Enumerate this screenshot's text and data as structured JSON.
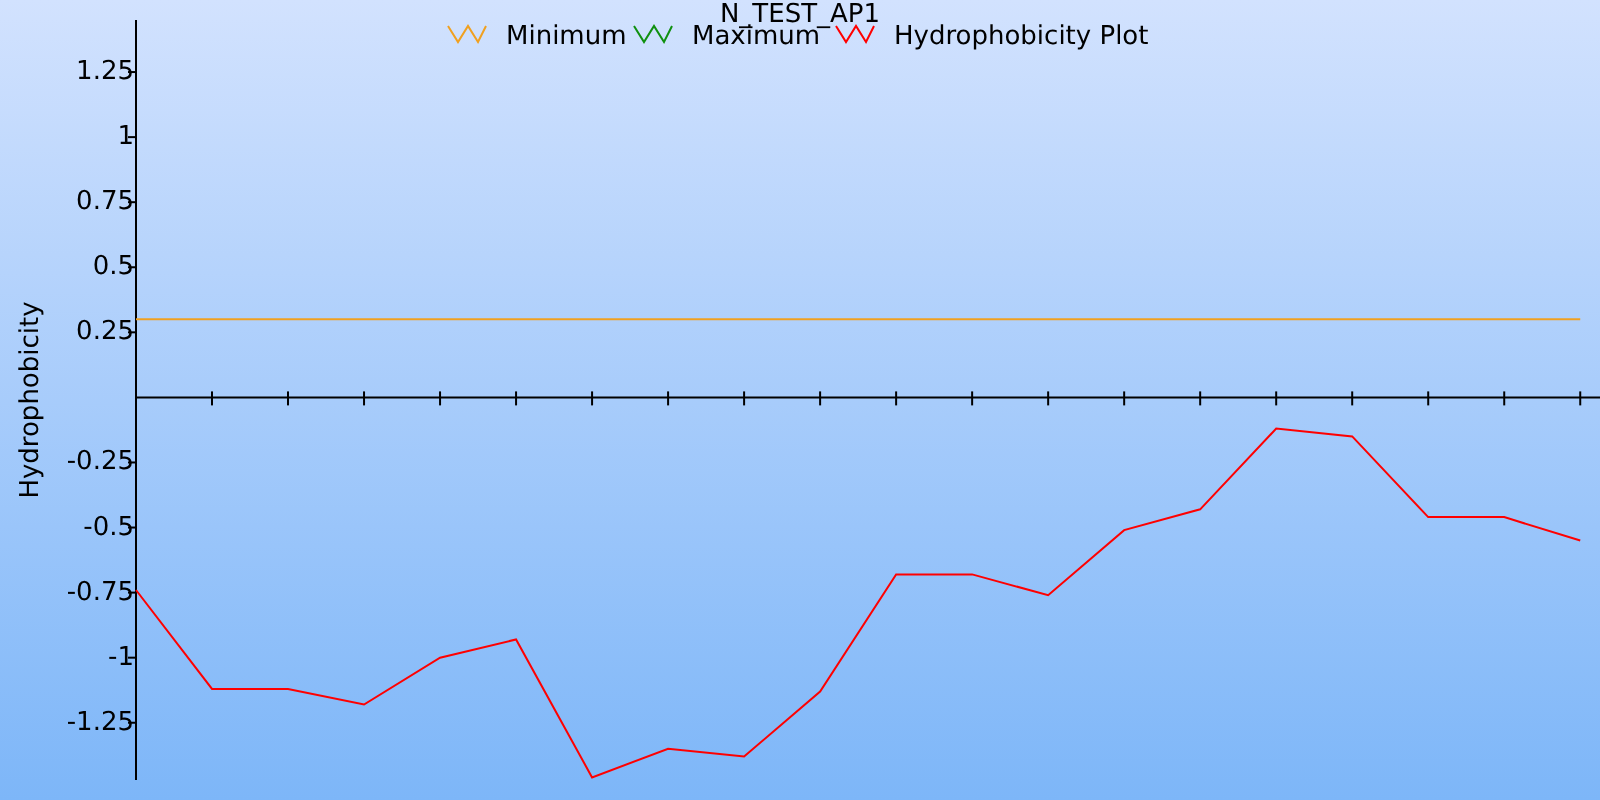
{
  "chart": {
    "title": "N_TEST_AP1",
    "chart_data": {
      "type": "line",
      "ylabel": "Hydrophobicity",
      "categories": [
        null,
        null,
        null,
        null,
        null,
        null,
        null,
        null,
        null,
        null,
        null,
        null,
        null,
        null,
        null,
        null,
        null,
        null,
        null,
        null
      ],
      "legend": "top",
      "ylim": [
        -1.47,
        1.45
      ],
      "yticks": [
        1.25,
        {
          "value": 1,
          "label": "1"
        },
        0.75,
        0.5,
        0.25,
        -0.25,
        -0.5,
        -0.75,
        {
          "value": -1,
          "label": "-1"
        },
        -1.25
      ],
      "series": [
        {
          "name": "Minimum",
          "color": "#f0a020",
          "values": [
            0.3,
            0.3,
            0.3,
            0.3,
            0.3,
            0.3,
            0.3,
            0.3,
            0.3,
            0.3,
            0.3,
            0.3,
            0.3,
            0.3,
            0.3,
            0.3,
            0.3,
            0.3,
            0.3,
            0.3
          ]
        },
        {
          "name": "Maximum",
          "color": "#109010",
          "values": [
            null,
            null,
            null,
            null,
            null,
            null,
            null,
            null,
            null,
            null,
            null,
            null,
            null,
            null,
            null,
            null,
            null,
            null,
            null,
            null
          ]
        },
        {
          "name": "Hydrophobicity Plot",
          "color": "#ff0000",
          "values": [
            -0.74,
            -1.12,
            -1.12,
            -1.18,
            -1.0,
            -0.93,
            -1.46,
            -1.35,
            -1.38,
            -1.13,
            -0.68,
            -0.68,
            -0.76,
            -0.51,
            -0.43,
            -0.12,
            -0.15,
            -0.46,
            -0.46,
            -0.55
          ]
        }
      ]
    }
  }
}
